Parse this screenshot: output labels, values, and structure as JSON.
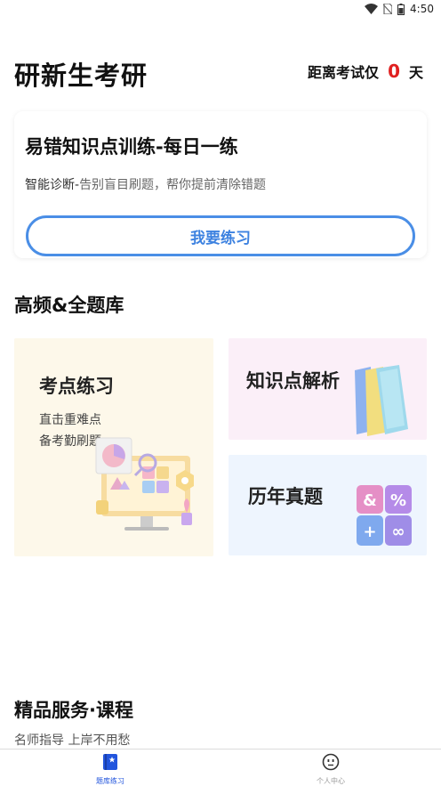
{
  "status_bar": {
    "time": "4:50"
  },
  "header": {
    "app_title": "研新生考研",
    "countdown_prefix": "距离考试仅",
    "countdown_days": "0",
    "countdown_suffix": "天"
  },
  "daily_card": {
    "title": "易错知识点训练-每日一练",
    "subtitle_highlight": "智能诊断-",
    "subtitle_rest": "告别盲目刷题，帮你提前清除错题",
    "button_label": "我要练习"
  },
  "question_bank": {
    "title": "高频&全题库",
    "tiles": [
      {
        "title": "考点练习",
        "lines": [
          "直击重难点",
          "备考勤刷题"
        ]
      },
      {
        "title": "知识点解析"
      },
      {
        "title": "历年真题"
      }
    ]
  },
  "courses": {
    "title": "精品服务·课程",
    "subtitle": "名师指导 上岸不用愁"
  },
  "bottom_nav": {
    "items": [
      {
        "label": "题库练习",
        "icon": "book-icon",
        "active": true
      },
      {
        "label": "个人中心",
        "icon": "face-icon",
        "active": false
      }
    ]
  },
  "colors": {
    "accent_blue": "#3d82e0",
    "countdown_red": "#e02020",
    "nav_active": "#2255dd"
  }
}
